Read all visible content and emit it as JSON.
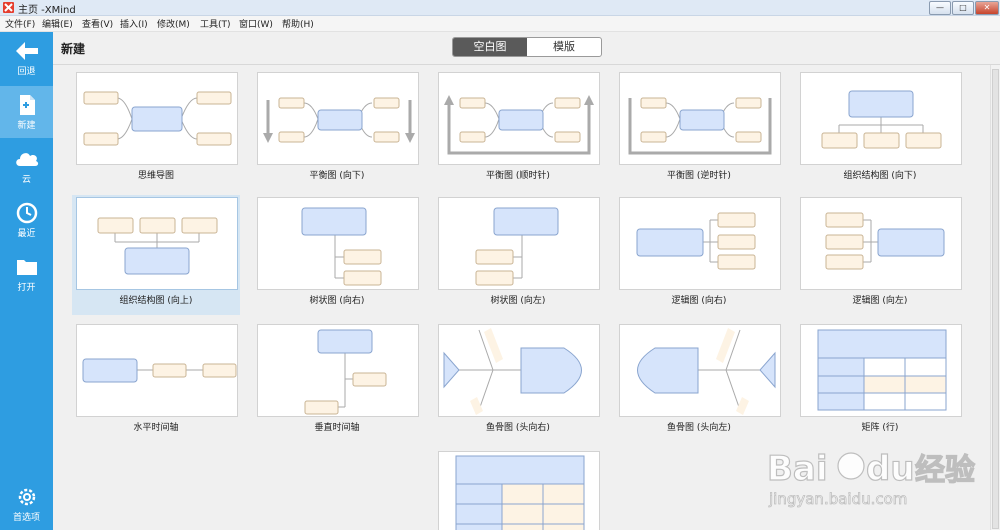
{
  "window": {
    "title": "主页 -XMind",
    "buttons": {
      "minimize": "—",
      "maximize": "□",
      "close": "✕"
    }
  },
  "menu": [
    {
      "id": "file",
      "label": "文件(F)"
    },
    {
      "id": "edit",
      "label": "编辑(E)"
    },
    {
      "id": "view",
      "label": "查看(V)"
    },
    {
      "id": "insert",
      "label": "插入(I)"
    },
    {
      "id": "modify",
      "label": "修改(M)"
    },
    {
      "id": "tools",
      "label": "工具(T)"
    },
    {
      "id": "window",
      "label": "窗口(W)"
    },
    {
      "id": "help",
      "label": "帮助(H)"
    }
  ],
  "sidebar": {
    "items": [
      {
        "id": "back",
        "label": "回退",
        "icon": "arrow-left-icon"
      },
      {
        "id": "new",
        "label": "新建",
        "icon": "new-file-icon",
        "active": true
      },
      {
        "id": "cloud",
        "label": "云",
        "icon": "cloud-icon"
      },
      {
        "id": "recent",
        "label": "最近",
        "icon": "clock-icon"
      },
      {
        "id": "open",
        "label": "打开",
        "icon": "folder-icon"
      }
    ],
    "settings": {
      "label": "首选项",
      "icon": "gear-icon"
    }
  },
  "main": {
    "heading": "新建",
    "tabs": [
      {
        "label": "空白图",
        "active": true
      },
      {
        "label": "模版",
        "active": false
      }
    ],
    "templates": [
      {
        "id": "mindmap",
        "label": "思维导图"
      },
      {
        "id": "balance-down",
        "label": "平衡图 (向下)"
      },
      {
        "id": "balance-cw",
        "label": "平衡图 (顺时针)"
      },
      {
        "id": "balance-ccw",
        "label": "平衡图 (逆时针)"
      },
      {
        "id": "org-down",
        "label": "组织结构图 (向下)"
      },
      {
        "id": "org-up",
        "label": "组织结构图 (向上)",
        "selected": true
      },
      {
        "id": "tree-right",
        "label": "树状图 (向右)"
      },
      {
        "id": "tree-left",
        "label": "树状图 (向左)"
      },
      {
        "id": "logic-right",
        "label": "逻辑图 (向右)"
      },
      {
        "id": "logic-left",
        "label": "逻辑图 (向左)"
      },
      {
        "id": "timeline-h",
        "label": "水平时间轴"
      },
      {
        "id": "timeline-v",
        "label": "垂直时间轴"
      },
      {
        "id": "fish-right",
        "label": "鱼骨图 (头向右)"
      },
      {
        "id": "fish-left",
        "label": "鱼骨图 (头向左)"
      },
      {
        "id": "matrix-row",
        "label": "矩阵 (行)"
      },
      {
        "id": "matrix-col",
        "label": ""
      }
    ]
  },
  "watermark": {
    "logo": "Baidu经验",
    "url": "jingyan.baidu.com"
  },
  "colors": {
    "sidebar": "#2e9de1",
    "sidebar_active": "#62b6ea",
    "central_topic": "#d6e4fb",
    "central_border": "#8aa5cf",
    "sub_topic": "#fdf3e4",
    "sub_border": "#c9b495",
    "selected_bg": "#d6e6f3"
  }
}
